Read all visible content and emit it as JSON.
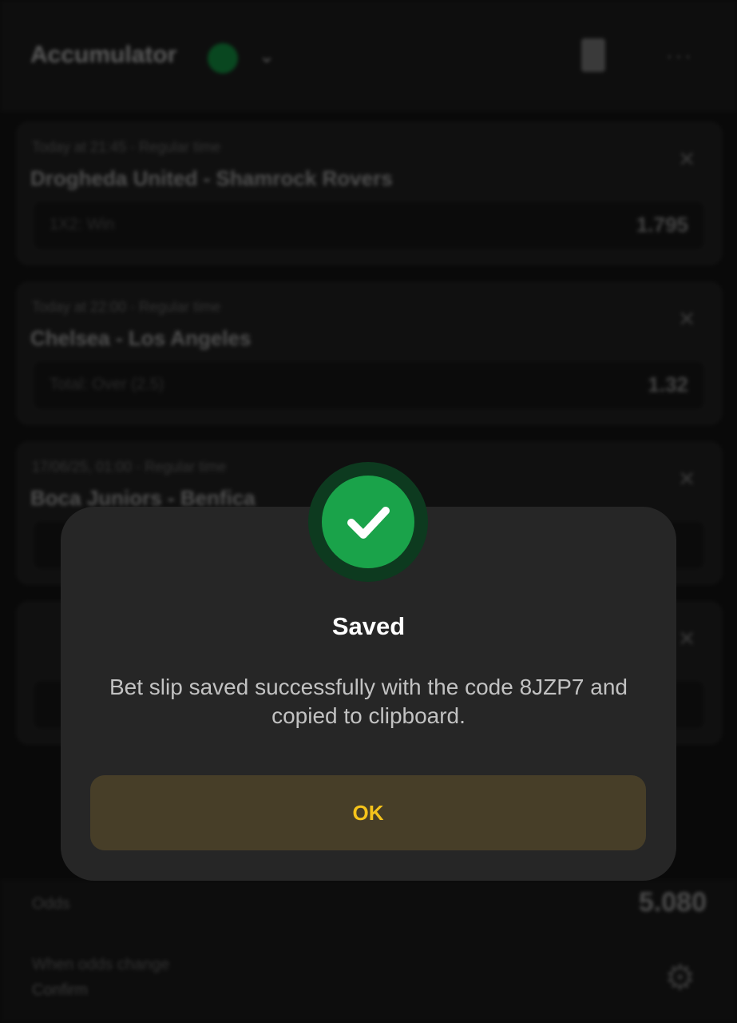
{
  "header": {
    "title": "Accumulator",
    "badge_icon": "green-circle-icon",
    "menu_icon": "chevron-down-icon",
    "trash_icon": "trash-icon",
    "more_icon": "more-icon"
  },
  "bets": [
    {
      "meta": "Today at 21:45 · Regular time",
      "teams": "Drogheda United - Shamrock Rovers",
      "pick": "1X2: Win",
      "odd": "1.795"
    },
    {
      "meta": "Today at 22:00 · Regular time",
      "teams": "Chelsea - Los Angeles",
      "pick": "Total: Over (2.5)",
      "odd": "1.32"
    },
    {
      "meta": "17/06/25, 01:00 · Regular time",
      "teams": "Boca Juniors - Benfica",
      "pick": "",
      "odd": ""
    },
    {
      "meta": "",
      "teams": "",
      "pick": "",
      "odd": ""
    }
  ],
  "summary": {
    "total_label": "Odds",
    "total_value": "5.080",
    "odds_change_label": "When odds change",
    "odds_change_value": "Confirm"
  },
  "dialog": {
    "icon": "check-icon",
    "title": "Saved",
    "message": "Bet slip saved successfully with the code 8JZP7 and copied to clipboard.",
    "ok_label": "OK"
  },
  "colors": {
    "accent": "#f5c31b",
    "success": "#1aa34a",
    "dialog_bg": "#262626",
    "button_bg": "#473e28"
  }
}
